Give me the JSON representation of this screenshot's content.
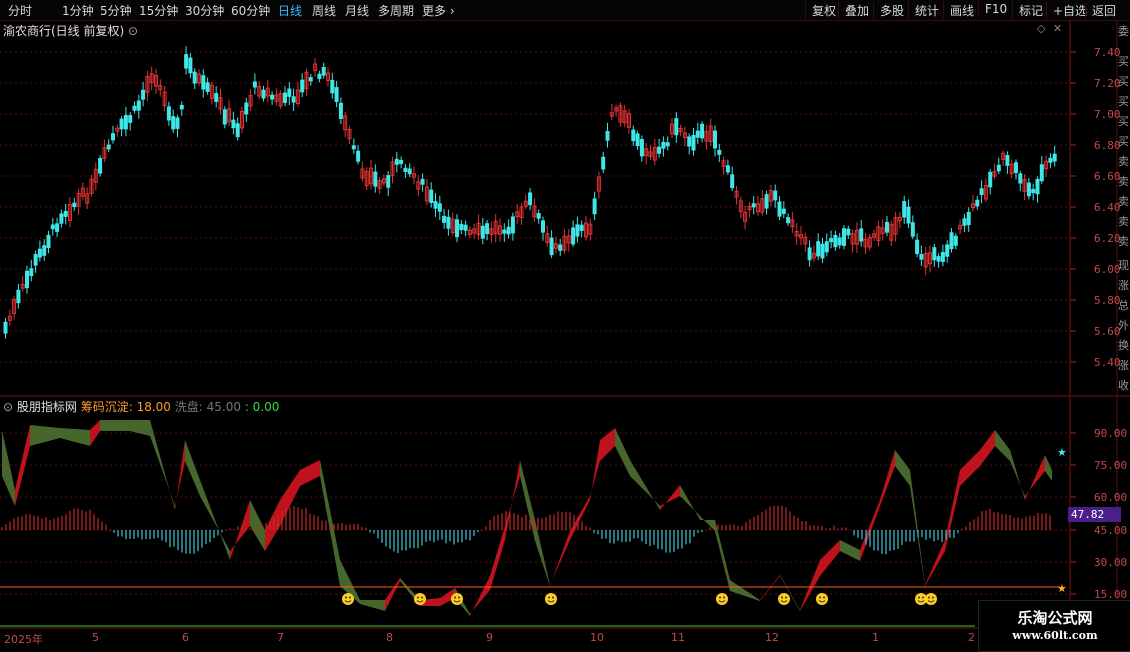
{
  "toolbar": {
    "periods": [
      "分时",
      "1分钟",
      "5分钟",
      "15分钟",
      "30分钟",
      "60分钟",
      "日线",
      "周线",
      "月线",
      "多周期",
      "更多"
    ],
    "active_period": "日线",
    "right_items": [
      "复权",
      "叠加",
      "多股",
      "统计",
      "画线",
      "F10",
      "标记",
      "+自选",
      "返回"
    ]
  },
  "main_chart": {
    "title": "渝农商行(日线 前复权)",
    "y_ticks": [
      "7.40",
      "7.20",
      "7.00",
      "6.80",
      "6.60",
      "6.40",
      "6.20",
      "6.00",
      "5.80",
      "5.60",
      "5.40"
    ]
  },
  "indicator": {
    "name": "股朋指标网",
    "label1": "筹码沉淀: 18.00",
    "label2": "洗盘: 45.00",
    "label3": ": 0.00",
    "y_ticks": [
      "90.00",
      "75.00",
      "60.00",
      "45.00",
      "30.00",
      "15.00"
    ],
    "current_value": "47.82"
  },
  "x_axis": {
    "labels": [
      "2025年",
      "5",
      "6",
      "7",
      "8",
      "9",
      "10",
      "11",
      "12",
      "1",
      "2"
    ]
  },
  "right_strip": [
    "委",
    "买",
    "买",
    "买",
    "买",
    "买",
    "卖",
    "卖",
    "卖",
    "卖",
    "卖",
    "现",
    "涨",
    "总",
    "外",
    "换",
    "涨",
    "收"
  ],
  "watermark": {
    "line1": "乐淘公式网",
    "line2": "www.60lt.com"
  },
  "colors": {
    "up": "#e03232",
    "down": "#3ee6e6",
    "grid": "#5a0e0e",
    "bull_band": "#c8141e",
    "bear_band": "#4a6b2e",
    "signal": "#ffcc22"
  }
}
